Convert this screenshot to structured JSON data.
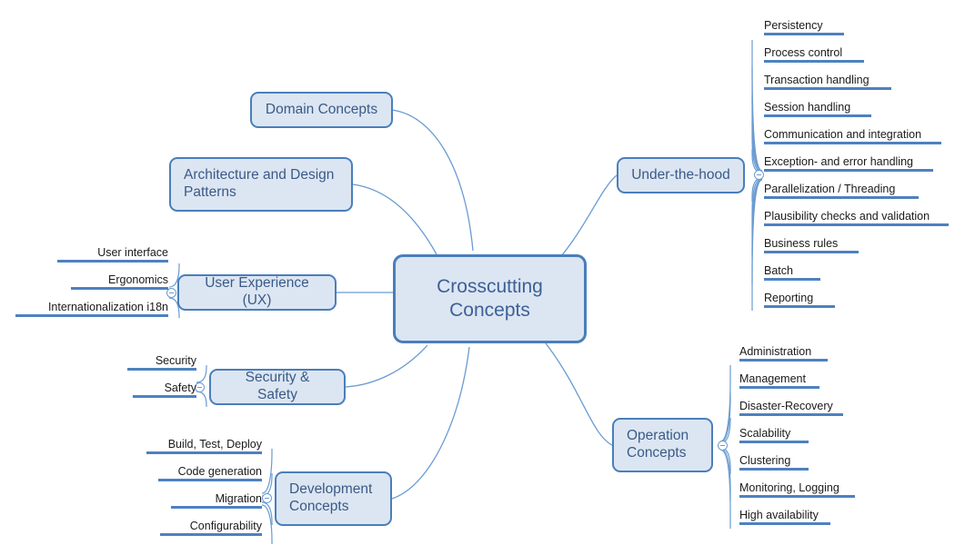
{
  "diagram": {
    "type": "mind-map",
    "title": "Crosscutting Concepts",
    "colors": {
      "node_fill": "#dce6f2",
      "node_border": "#4a7ebb",
      "node_text": "#3a5a87",
      "leaf_text": "#1a1a1a",
      "leaf_underline": "#4e81c0",
      "connector": "#6a9bd1",
      "background": "#ffffff"
    }
  },
  "root": {
    "label": "Crosscutting\nConcepts"
  },
  "branches": [
    {
      "id": "domain-concepts",
      "label": "Domain Concepts",
      "side": "left",
      "children": []
    },
    {
      "id": "architecture-and-design-patterns",
      "label": "Architecture and Design\nPatterns",
      "side": "left",
      "children": []
    },
    {
      "id": "user-experience-ux",
      "label": "User Experience (UX)",
      "side": "left",
      "collapser": true,
      "children": [
        {
          "label": "User interface"
        },
        {
          "label": "Ergonomics"
        },
        {
          "label": "Internationalization i18n"
        }
      ]
    },
    {
      "id": "security-and-safety",
      "label": "Security & Safety",
      "side": "left",
      "collapser": true,
      "children": [
        {
          "label": "Security"
        },
        {
          "label": "Safety"
        }
      ]
    },
    {
      "id": "development-concepts",
      "label": "Development\nConcepts",
      "side": "left",
      "collapser": true,
      "children": [
        {
          "label": "Build, Test, Deploy"
        },
        {
          "label": "Code generation"
        },
        {
          "label": "Migration"
        },
        {
          "label": "Configurability"
        }
      ]
    },
    {
      "id": "under-the-hood",
      "label": "Under-the-hood",
      "side": "right",
      "collapser": true,
      "children": [
        {
          "label": "Persistency"
        },
        {
          "label": "Process control"
        },
        {
          "label": "Transaction handling"
        },
        {
          "label": "Session handling"
        },
        {
          "label": "Communication and integration"
        },
        {
          "label": "Exception- and error handling"
        },
        {
          "label": "Parallelization / Threading"
        },
        {
          "label": "Plausibility checks and validation"
        },
        {
          "label": "Business rules"
        },
        {
          "label": "Batch"
        },
        {
          "label": "Reporting"
        }
      ]
    },
    {
      "id": "operation-concepts",
      "label": "Operation\nConcepts",
      "side": "right",
      "collapser": true,
      "children": [
        {
          "label": "Administration"
        },
        {
          "label": "Management"
        },
        {
          "label": "Disaster-Recovery"
        },
        {
          "label": "Scalability"
        },
        {
          "label": "Clustering"
        },
        {
          "label": "Monitoring, Logging"
        },
        {
          "label": "High availability"
        }
      ]
    }
  ]
}
